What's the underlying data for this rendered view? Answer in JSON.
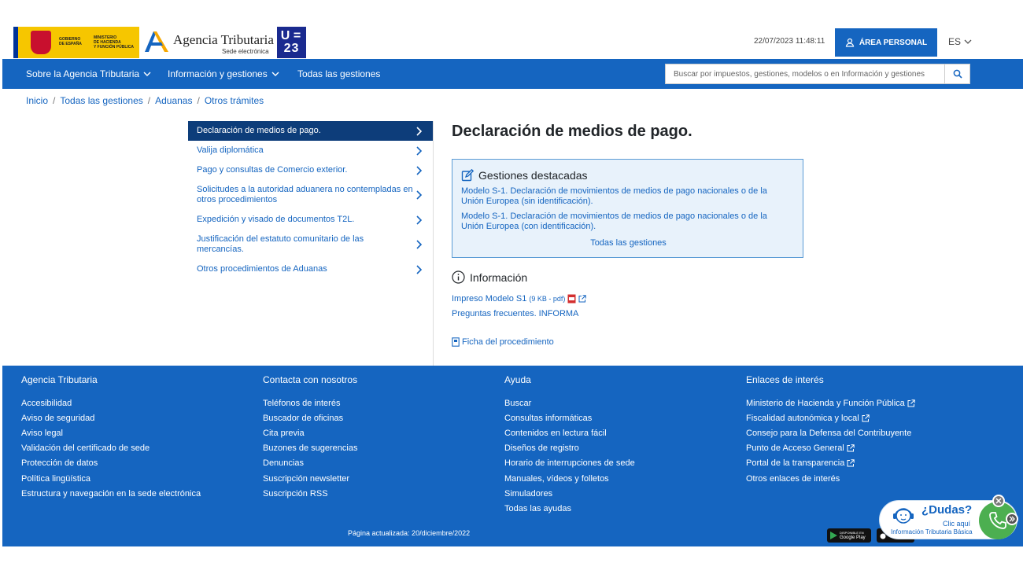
{
  "header": {
    "gov_logo": {
      "line1": "GOBIERNO",
      "line2": "DE ESPAÑA",
      "line3": "MINISTERIO",
      "line4": "DE HACIENDA",
      "line5": "Y FUNCIÓN PÚBLICA"
    },
    "agency_name": "Agencia Tributaria",
    "agency_sub": "Sede electrónica",
    "eu_badge_top": "U",
    "eu_badge_mid": "=",
    "eu_badge_bottom": "23",
    "datetime": "22/07/2023 11:48:11",
    "area_personal_label": "ÁREA PERSONAL",
    "language": "ES"
  },
  "nav": {
    "items": [
      {
        "label": "Sobre la Agencia Tributaria",
        "has_dropdown": true
      },
      {
        "label": "Información y gestiones",
        "has_dropdown": true
      },
      {
        "label": "Todas las gestiones",
        "has_dropdown": false
      }
    ],
    "search_placeholder": "Buscar por impuestos, gestiones, modelos o en Información y gestiones"
  },
  "breadcrumb": [
    "Inicio",
    "Todas las gestiones",
    "Aduanas",
    "Otros trámites"
  ],
  "sidemenu": {
    "items": [
      {
        "label": "Declaración de medios de pago.",
        "active": true
      },
      {
        "label": "Valija diplomática",
        "active": false
      },
      {
        "label": "Pago y consultas de Comercio exterior.",
        "active": false
      },
      {
        "label": "Solicitudes a la autoridad aduanera no contempladas en otros procedimientos",
        "active": false
      },
      {
        "label": "Expedición y visado de documentos T2L.",
        "active": false
      },
      {
        "label": "Justificación del estatuto comunitario de las mercancías.",
        "active": false
      },
      {
        "label": "Otros procedimientos de Aduanas",
        "active": false
      }
    ]
  },
  "main": {
    "title": "Declaración de medios de pago.",
    "gestiones": {
      "heading": "Gestiones destacadas",
      "links": [
        "Modelo S-1. Declaración de movimientos de medios de pago nacionales o de la Unión Europea (sin identificación).",
        "Modelo S-1. Declaración de movimientos de medios de pago nacionales o de la Unión Europea (con identificación)."
      ],
      "all_label": "Todas las gestiones"
    },
    "info": {
      "heading": "Información",
      "impreso_label": "Impreso Modelo S1",
      "impreso_size": "(9 KB - pdf)",
      "faq_label": "Preguntas frecuentes. INFORMA",
      "ficha_label": "Ficha del procedimiento"
    }
  },
  "footer": {
    "columns": [
      {
        "title": "Agencia Tributaria",
        "links": [
          {
            "label": "Accesibilidad",
            "external": false
          },
          {
            "label": "Aviso de seguridad",
            "external": false
          },
          {
            "label": "Aviso legal",
            "external": false
          },
          {
            "label": "Validación del certificado de sede",
            "external": false
          },
          {
            "label": "Protección de datos",
            "external": false
          },
          {
            "label": "Política lingüística",
            "external": false
          },
          {
            "label": "Estructura y navegación en la sede electrónica",
            "external": false
          }
        ]
      },
      {
        "title": "Contacta con nosotros",
        "links": [
          {
            "label": "Teléfonos de interés",
            "external": false
          },
          {
            "label": "Buscador de oficinas",
            "external": false
          },
          {
            "label": "Cita previa",
            "external": false
          },
          {
            "label": "Buzones de sugerencias",
            "external": false
          },
          {
            "label": "Denuncias",
            "external": false
          },
          {
            "label": "Suscripción newsletter",
            "external": false
          },
          {
            "label": "Suscripción RSS",
            "external": false
          }
        ]
      },
      {
        "title": "Ayuda",
        "links": [
          {
            "label": "Buscar",
            "external": false
          },
          {
            "label": "Consultas informáticas",
            "external": false
          },
          {
            "label": "Contenidos en lectura fácil",
            "external": false
          },
          {
            "label": "Diseños de registro",
            "external": false
          },
          {
            "label": "Horario de interrupciones de sede",
            "external": false
          },
          {
            "label": "Manuales, vídeos y folletos",
            "external": false
          },
          {
            "label": "Simuladores",
            "external": false
          },
          {
            "label": "Todas las ayudas",
            "external": false
          }
        ]
      },
      {
        "title": "Enlaces de interés",
        "links": [
          {
            "label": "Ministerio de Hacienda y Función Pública",
            "external": true
          },
          {
            "label": "Fiscalidad autonómica y local",
            "external": true
          },
          {
            "label": "Consejo para la Defensa del Contribuyente",
            "external": false
          },
          {
            "label": "Punto de Acceso General",
            "external": true
          },
          {
            "label": "Portal de la transparencia",
            "external": true
          },
          {
            "label": "Otros enlaces de interés",
            "external": false
          }
        ]
      }
    ],
    "updated": "Página actualizada: 20/diciembre/2022",
    "google_play_label": "Google Play",
    "google_play_small": "DISPONIBLE EN"
  },
  "dudas": {
    "title": "¿Dudas?",
    "sub": "Clic aquí",
    "sub2": "Información Tributaria Básica"
  },
  "colors": {
    "primary": "#1565c0",
    "active_menu": "#0d3d7a",
    "gestiones_bg": "#e8f2fb",
    "gestiones_border": "#5b9bd5",
    "pdf_red": "#d32f2f",
    "whatsapp_green": "#4caf50"
  },
  "icons": {
    "user": "user-icon",
    "search": "search-icon",
    "chevron_down": "chevron-down-icon",
    "chevron_right": "chevron-right-icon",
    "edit": "edit-icon",
    "info": "info-icon",
    "pdf": "pdf-icon",
    "external_link": "external-link-icon",
    "document": "document-icon",
    "phone": "phone-icon",
    "close": "close-icon"
  }
}
